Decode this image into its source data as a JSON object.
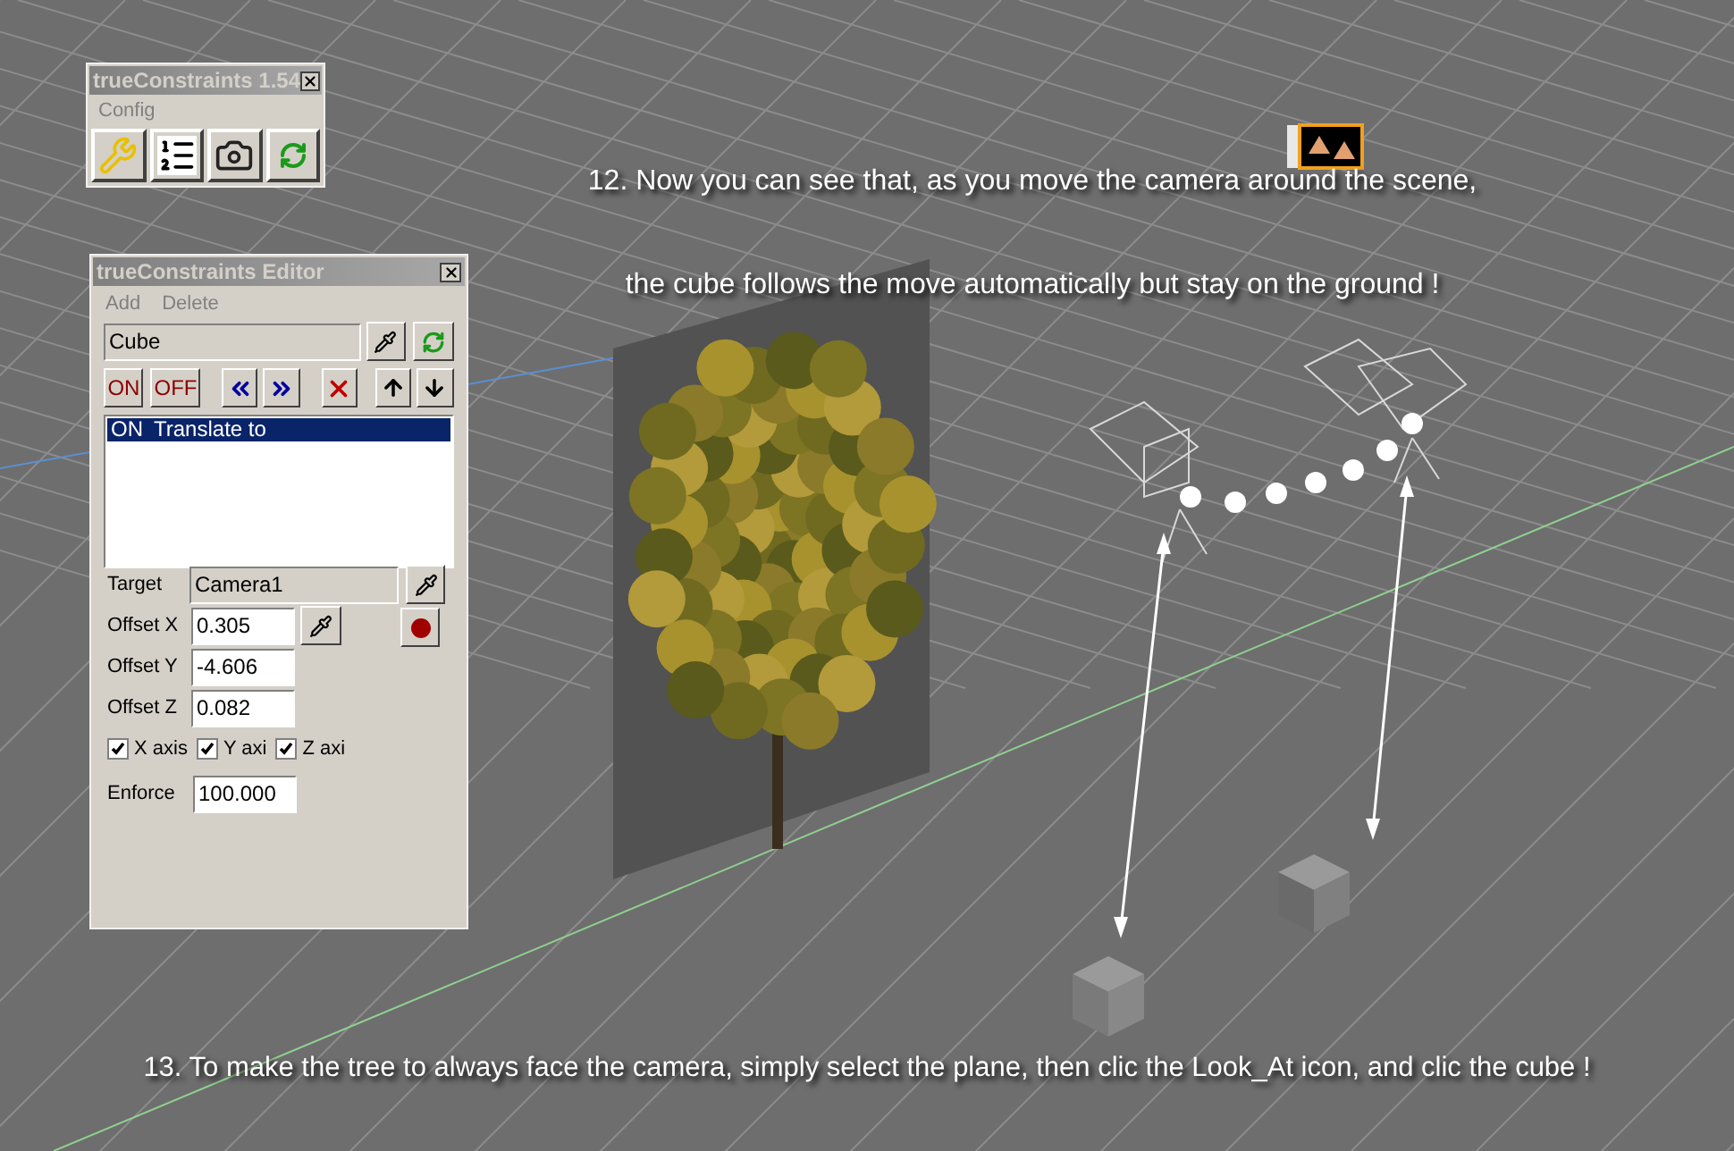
{
  "toolbar_window": {
    "title": "trueConstraints 1.54",
    "menu": [
      "Config"
    ]
  },
  "editor_window": {
    "title": "trueConstraints Editor",
    "menu": [
      "Add",
      "Delete"
    ],
    "object_field": {
      "value": "Cube"
    },
    "buttons": [
      {
        "label": "ON",
        "kind": "text"
      },
      {
        "label": "OFF",
        "kind": "text"
      }
    ],
    "constraints": [
      {
        "state": "ON",
        "name": "Translate to",
        "selected": true
      }
    ],
    "target": {
      "label": "Target",
      "value": "Camera1"
    },
    "offsets": [
      {
        "label": "Offset X",
        "value": "0.305"
      },
      {
        "label": "Offset Y",
        "value": "-4.606"
      },
      {
        "label": "Offset Z",
        "value": "0.082"
      }
    ],
    "axes": [
      {
        "label": "X axis",
        "checked": true
      },
      {
        "label": "Y axi",
        "checked": true
      },
      {
        "label": "Z axi",
        "checked": true
      }
    ],
    "enforce": {
      "label": "Enforce",
      "value": "100.000"
    }
  },
  "captions": [
    "12. Now you can see that, as you move the camera around the scene,",
    "the cube follows the move automatically but stay on the ground !",
    "13. To make the tree to always face the camera, simply select the plane, then clic the Look_At icon, and clic the cube !"
  ]
}
